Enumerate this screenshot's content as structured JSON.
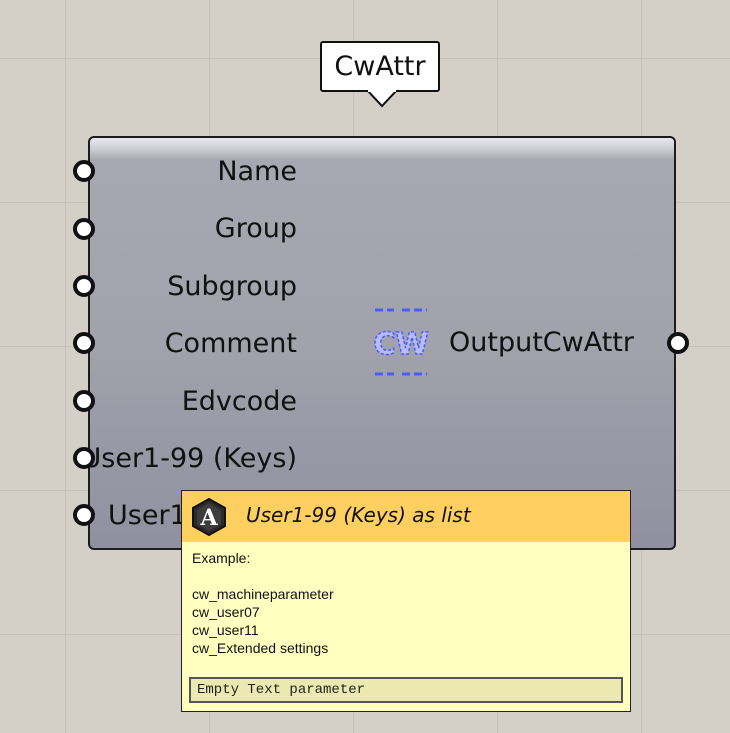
{
  "component": {
    "nickname": "CwAttr",
    "inputs": [
      {
        "label": "Name"
      },
      {
        "label": "Group"
      },
      {
        "label": "Subgroup"
      },
      {
        "label": "Comment"
      },
      {
        "label": "Edvcode"
      },
      {
        "label": "User1-99 (Keys)"
      },
      {
        "label": "User1"
      }
    ],
    "output": {
      "label": "OutputCwAttr"
    },
    "icon": {
      "name": "cw-icon",
      "text": "CW",
      "color": "#4a5cff"
    }
  },
  "tooltip": {
    "icon": "text-param-icon",
    "icon_letter": "A",
    "title": "User1-99 (Keys) as list",
    "body_lines": [
      "Example:",
      "",
      "cw_machineparameter",
      "cw_user07",
      "cw_user11",
      "cw_Extended settings"
    ],
    "status": "Empty Text parameter",
    "header_color": "#ffcf60",
    "body_color": "#ffffc0"
  },
  "canvas": {
    "background": "#d4d0c8"
  }
}
